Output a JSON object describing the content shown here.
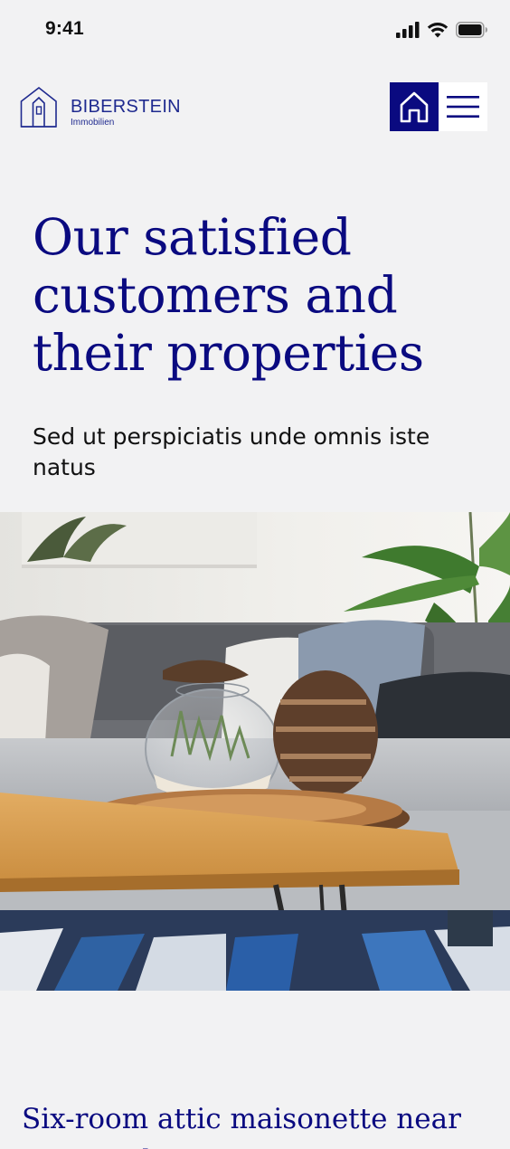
{
  "status_bar": {
    "time": "9:41"
  },
  "brand": {
    "name": "BIBERSTEIN",
    "tagline": "Immobilien",
    "color": "#1f2a8f"
  },
  "nav": {
    "home_icon": "home-icon",
    "menu_icon": "hamburger-menu-icon",
    "accent": "#0a0a80"
  },
  "hero": {
    "title": "Our satisfied customers and their properties",
    "subtitle": "Sed ut perspiciatis unde omnis iste natus"
  },
  "listing": {
    "title": "Six-room attic maisonette near Marienplatz"
  }
}
